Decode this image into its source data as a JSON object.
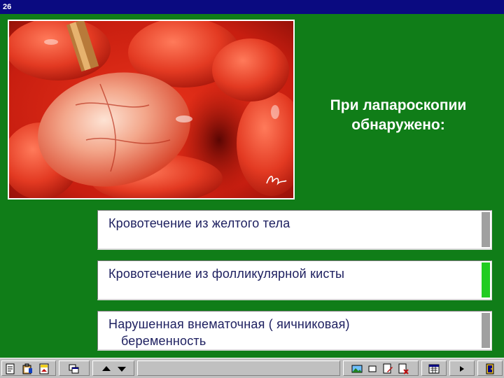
{
  "window": {
    "title": "26"
  },
  "question": {
    "line1": "При лапароскопии",
    "line2": "обнаружено:"
  },
  "answers": [
    {
      "line1": "Кровотечение из желтого тела",
      "line2": "",
      "indicator_color": "#a0a0a0"
    },
    {
      "line1": "Кровотечение из фолликулярной кисты",
      "line2": "",
      "indicator_color": "#22cc22"
    },
    {
      "line1": "Нарушенная внематочная ( яичниковая)",
      "line2": "беременность",
      "indicator_color": "#a0a0a0"
    }
  ],
  "colors": {
    "stage_background": "#107d18",
    "titlebar": "#0a0a80",
    "answer_text": "#1e2060",
    "selected_indicator": "#22cc22"
  },
  "toolbar": {
    "icons": [
      "notes-icon",
      "clipboard-icon",
      "bookmark-icon",
      "windows-icon",
      "arrow-up-icon",
      "arrow-down-icon",
      "landscape-image-icon",
      "window-icon",
      "page-edit-icon",
      "page-delete-icon",
      "calendar-icon",
      "play-right-icon",
      "exit-door-icon"
    ]
  }
}
